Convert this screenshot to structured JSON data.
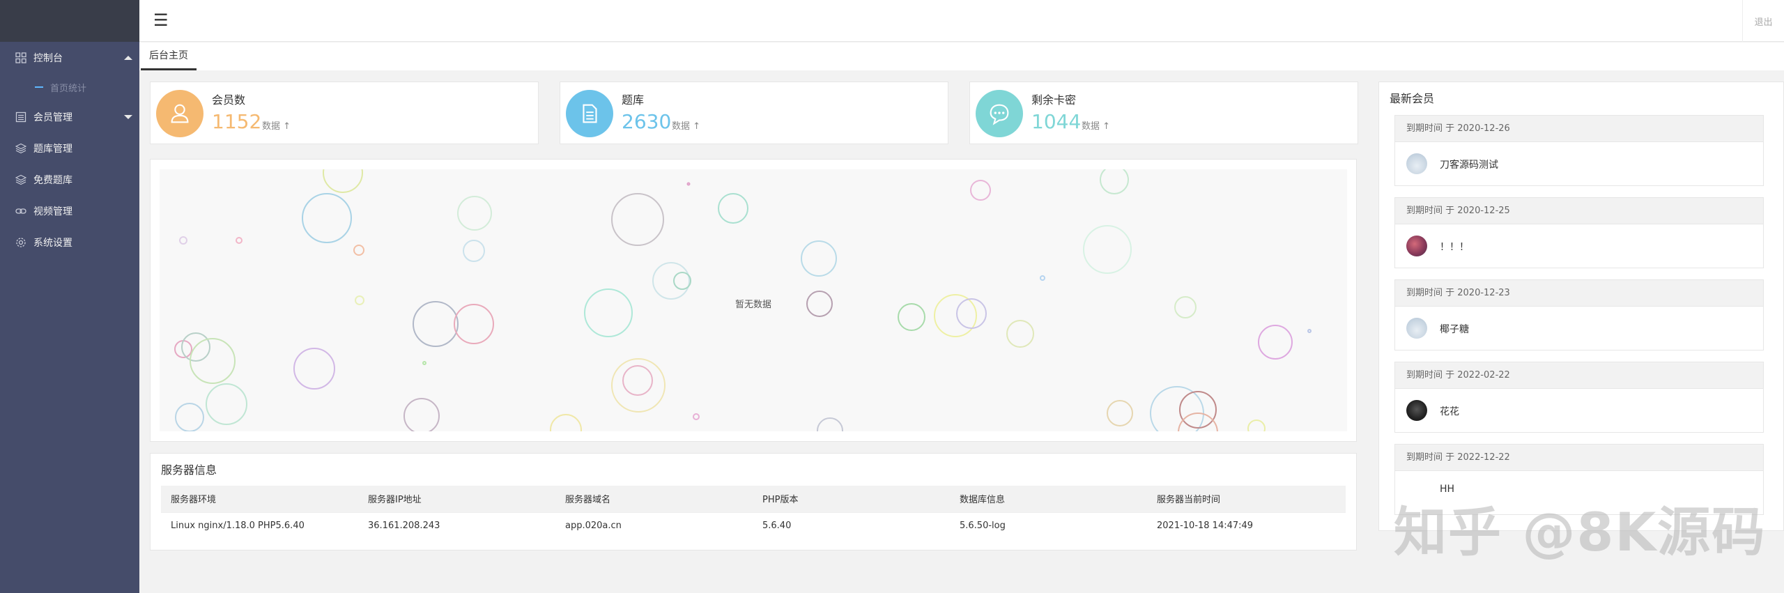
{
  "sidebar": {
    "items": [
      {
        "label": "控制台",
        "icon": "grid-icon",
        "expanded": true
      },
      {
        "label": "会员管理",
        "icon": "list-icon",
        "expanded": false
      },
      {
        "label": "题库管理",
        "icon": "layers-icon"
      },
      {
        "label": "免费题库",
        "icon": "layers-icon"
      },
      {
        "label": "视频管理",
        "icon": "link-icon"
      },
      {
        "label": "系统设置",
        "icon": "gear-icon"
      }
    ],
    "sub_item": "首页统计"
  },
  "header": {
    "menu_icon": "☰",
    "logout": "退出"
  },
  "tabs": {
    "home": "后台主页"
  },
  "stats": [
    {
      "title": "会员数",
      "value": "1152",
      "unit": "数据",
      "color": "#f5b971",
      "icon": "user-icon"
    },
    {
      "title": "题库",
      "value": "2630",
      "unit": "数据",
      "color": "#6cc3ea",
      "icon": "document-icon"
    },
    {
      "title": "剩余卡密",
      "value": "1044",
      "unit": "数据",
      "color": "#7fd6d6",
      "icon": "chat-icon"
    }
  ],
  "chart": {
    "empty_text": "暂无数据"
  },
  "server": {
    "title": "服务器信息",
    "headers": [
      "服务器环境",
      "服务器IP地址",
      "服务器域名",
      "PHP版本",
      "数据库信息",
      "服务器当前时间"
    ],
    "row": [
      "Linux nginx/1.18.0 PHP5.6.40",
      "36.161.208.243",
      "app.020a.cn",
      "5.6.40",
      "5.6.50-log",
      "2021-10-18 14:47:49"
    ]
  },
  "members": {
    "title": "最新会员",
    "list": [
      {
        "expire": "到期时间 于 2020-12-26",
        "name": "刀客源码测试"
      },
      {
        "expire": "到期时间 于 2020-12-25",
        "name": "！！！"
      },
      {
        "expire": "到期时间 于 2020-12-23",
        "name": "椰子糖"
      },
      {
        "expire": "到期时间 于 2022-02-22",
        "name": "花花"
      },
      {
        "expire": "到期时间 于 2022-12-22",
        "name": "HH"
      }
    ]
  },
  "watermark": "知乎 @8K源码"
}
